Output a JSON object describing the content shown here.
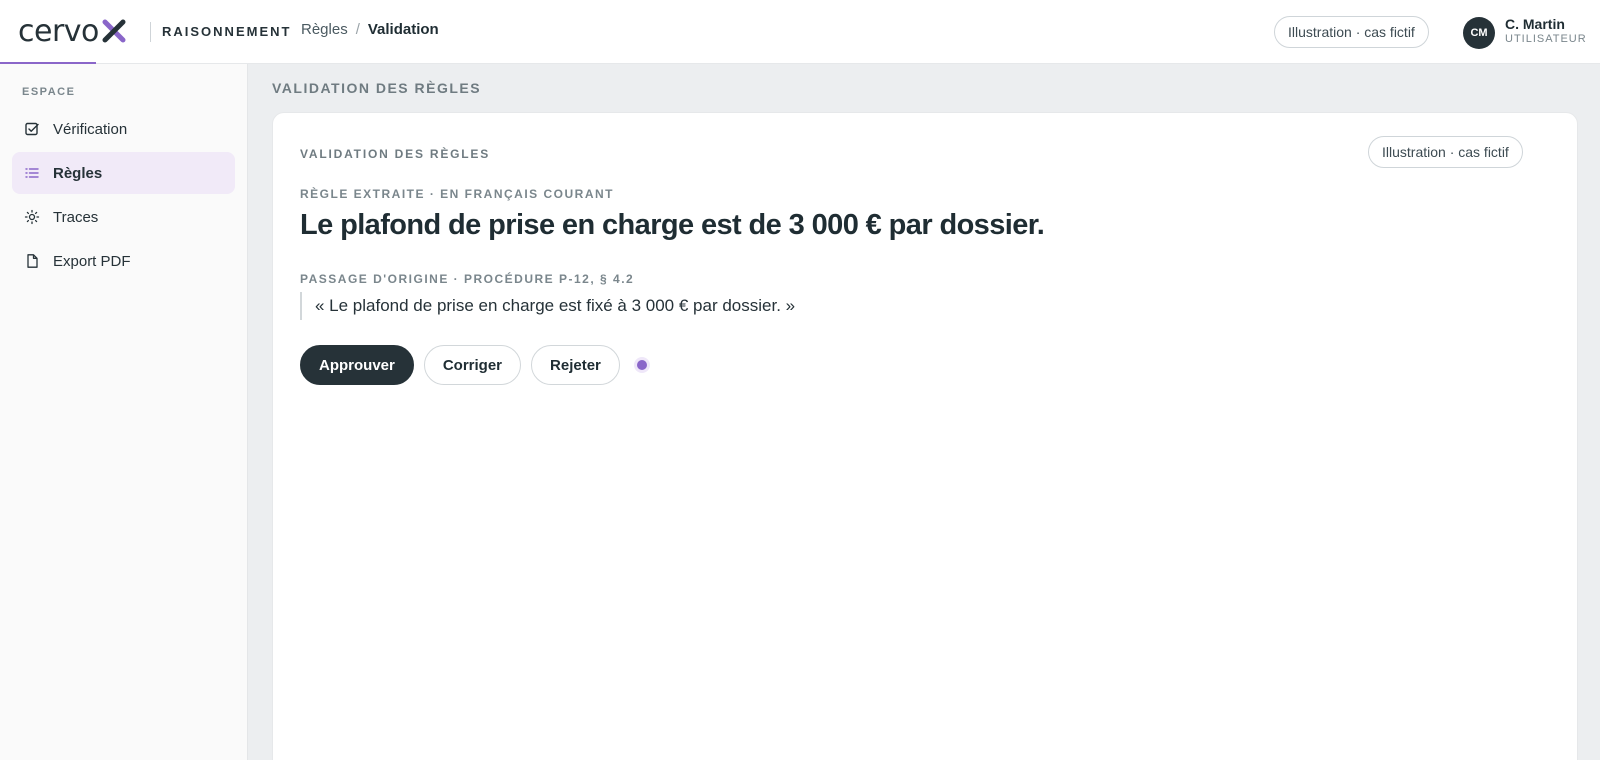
{
  "colors": {
    "accent": "#8a66c9",
    "dark": "#263238",
    "active_nav_bg": "#f1eaf8",
    "main_bg": "#eceef0"
  },
  "header": {
    "logo_text": "cervo",
    "logo_mark_icon": "x-mark-icon",
    "product_name": "RAISONNEMENT",
    "breadcrumb": {
      "parent": "Règles",
      "separator": "/",
      "current": "Validation"
    },
    "illustration_badge": "Illustration · cas fictif",
    "user": {
      "initials": "CM",
      "name": "C. Martin",
      "role": "UTILISATEUR"
    }
  },
  "sidebar": {
    "section_label": "ESPACE",
    "items": [
      {
        "label": "Vérification",
        "icon": "checkbox-icon",
        "active": false
      },
      {
        "label": "Règles",
        "icon": "list-icon",
        "active": true
      },
      {
        "label": "Traces",
        "icon": "sun-icon",
        "active": false
      },
      {
        "label": "Export PDF",
        "icon": "document-icon",
        "active": false
      }
    ]
  },
  "main": {
    "page_heading": "VALIDATION DES RÈGLES",
    "card": {
      "label": "VALIDATION DES RÈGLES",
      "illustration_badge": "Illustration · cas fictif",
      "rule_kicker": "RÈGLE EXTRAITE · EN FRANÇAIS COURANT",
      "rule_text": "Le plafond de prise en charge est de 3 000 € par dossier.",
      "source_kicker": "PASSAGE D'ORIGINE · PROCÉDURE P-12, § 4.2",
      "source_quote": "« Le plafond de prise en charge est fixé à 3 000 € par dossier. »",
      "actions": {
        "approve": "Approuver",
        "correct": "Corriger",
        "reject": "Rejeter"
      }
    }
  }
}
